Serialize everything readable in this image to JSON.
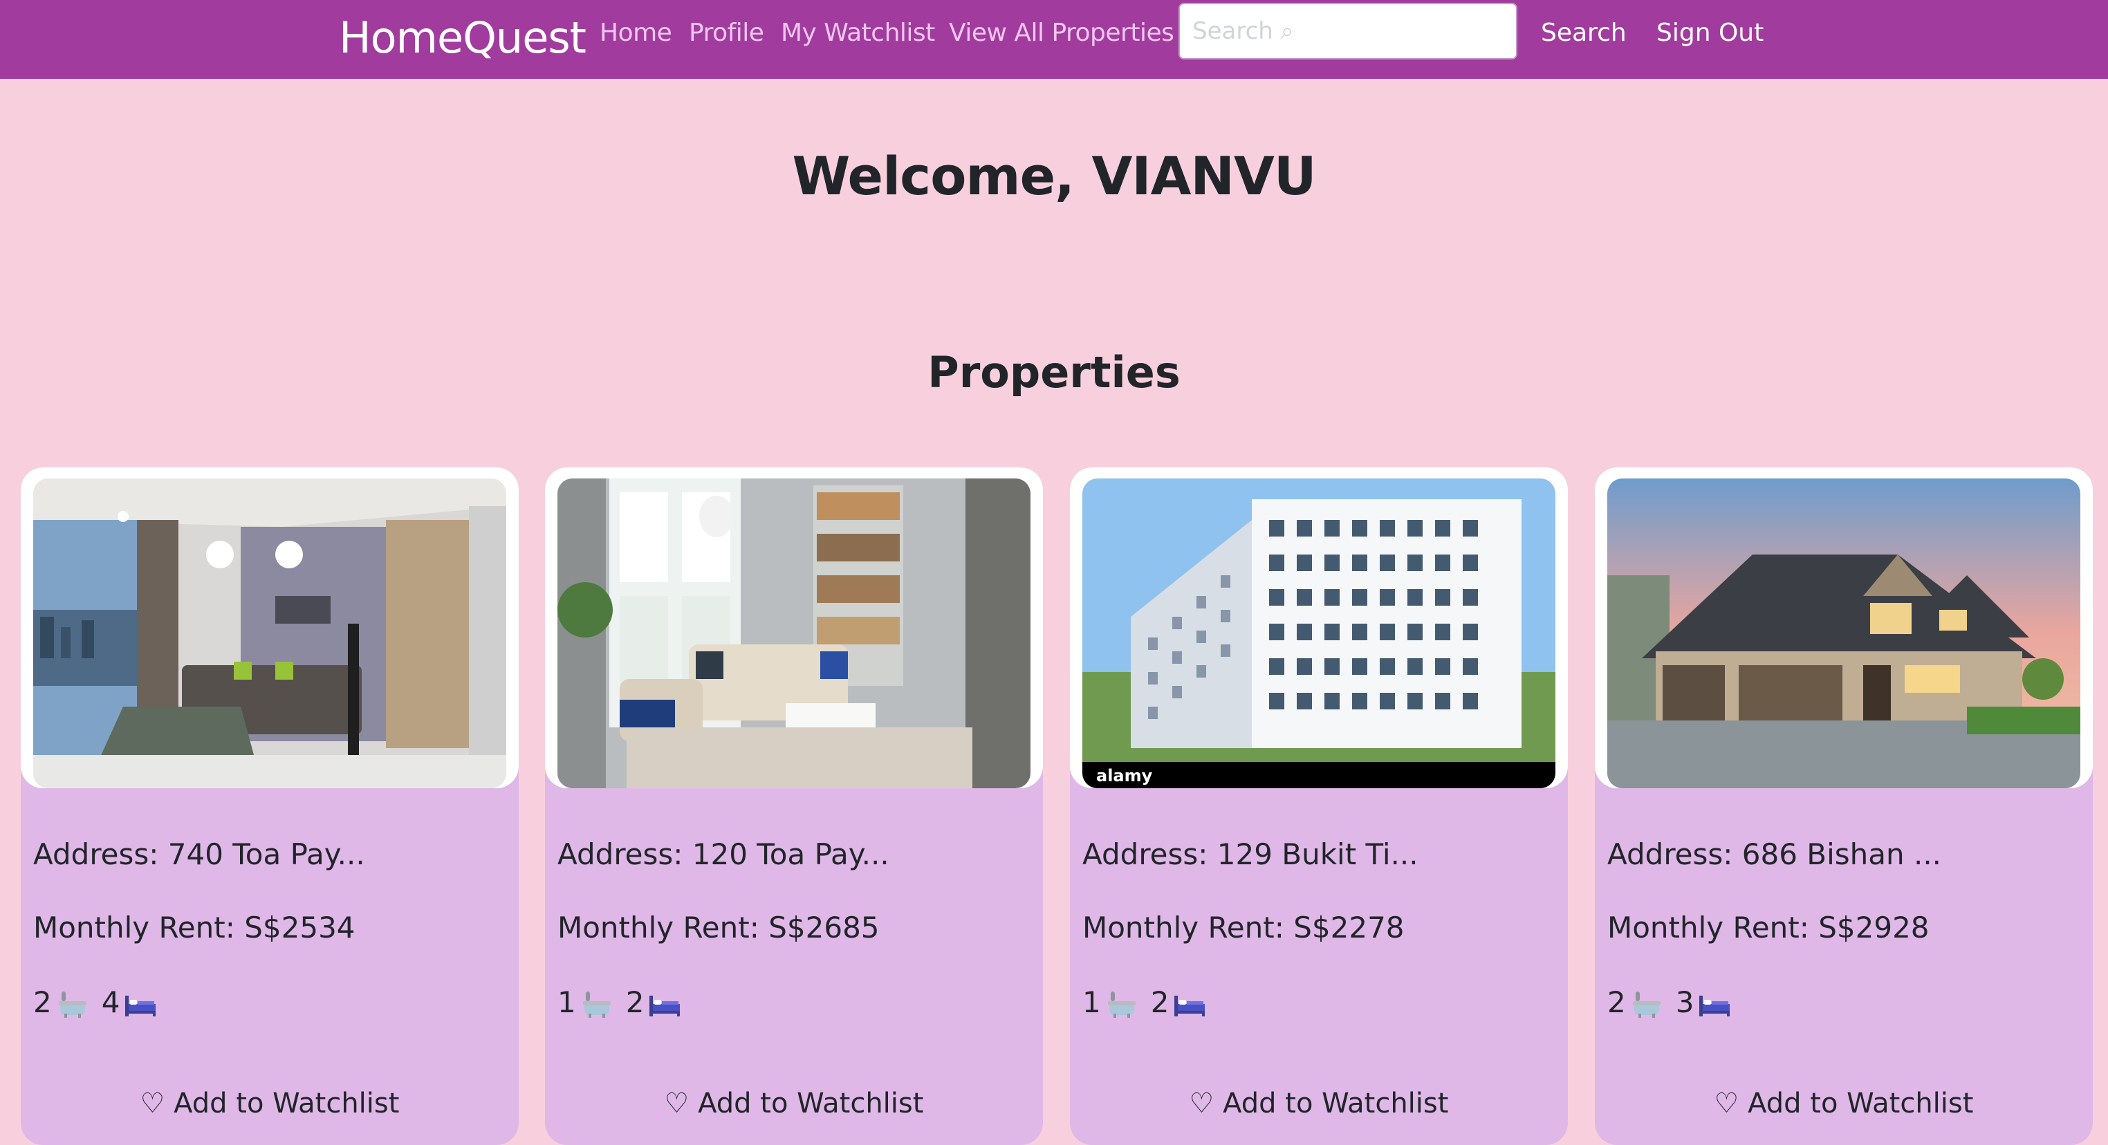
{
  "navbar": {
    "brand": "HomeQuest",
    "links": [
      "Home",
      "Profile",
      "My Watchlist",
      "View All Properties"
    ],
    "search_placeholder": "Search ⌕",
    "search_button": "Search",
    "signout_button": "Sign Out"
  },
  "welcome": "Welcome, VIANVU",
  "section_title": "Properties",
  "cards": [
    {
      "image": "living-room-balcony-photo",
      "address": "Address: 740 Toa Pay...",
      "rent": "Monthly Rent: S$2534",
      "baths": "2",
      "beds": "4",
      "watch_label": "♡ Add to Watchlist"
    },
    {
      "image": "bright-living-room-photo",
      "address": "Address: 120 Toa Pay...",
      "rent": "Monthly Rent: S$2685",
      "baths": "1",
      "beds": "2",
      "watch_label": "♡ Add to Watchlist"
    },
    {
      "image": "white-apartment-block-photo",
      "address": "Address: 129 Bukit Ti...",
      "rent": "Monthly Rent: S$2278",
      "baths": "1",
      "beds": "2",
      "watch_label": "♡ Add to Watchlist",
      "image_watermark": "alamy"
    },
    {
      "image": "suburban-house-sunset-photo",
      "address": "Address: 686 Bishan ...",
      "rent": "Monthly Rent: S$2928",
      "baths": "2",
      "beds": "3",
      "watch_label": "♡ Add to Watchlist"
    }
  ],
  "colors": {
    "navbar_bg": "#a13c9e",
    "page_bg": "#f8d0dd",
    "card_bg": "#dfb8e8",
    "nav_link": "#f1c6ee"
  }
}
